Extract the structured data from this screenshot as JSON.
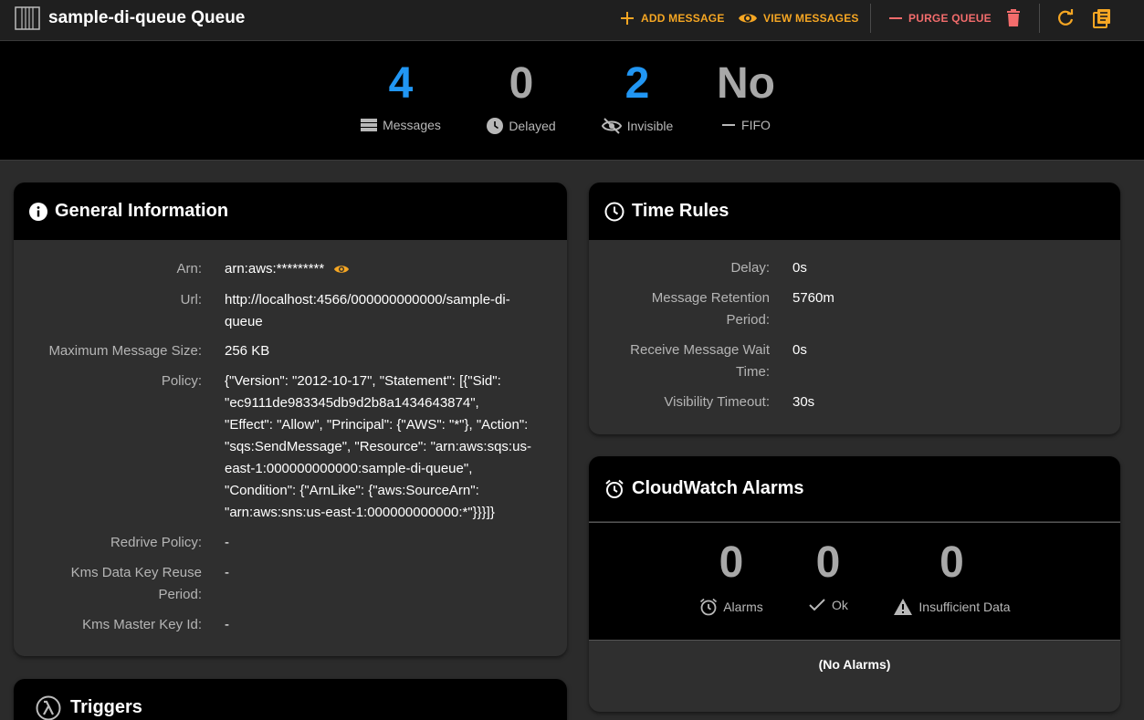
{
  "header": {
    "title": "sample-di-queue Queue",
    "add_message": "ADD MESSAGE",
    "view_messages": "VIEW MESSAGES",
    "purge_queue": "PURGE QUEUE"
  },
  "stats": [
    {
      "value": "4",
      "label": "Messages",
      "icon": "messages-icon",
      "color": "#2196f3"
    },
    {
      "value": "0",
      "label": "Delayed",
      "icon": "clock-icon",
      "color": "#a8a8a8"
    },
    {
      "value": "2",
      "label": "Invisible",
      "icon": "eye-off-icon",
      "color": "#2196f3"
    },
    {
      "value": "No",
      "label": "FIFO",
      "icon": "dash-icon",
      "color": "#a8a8a8"
    }
  ],
  "general": {
    "title": "General Information",
    "arn_label": "Arn:",
    "arn_value": "arn:aws:*********",
    "url_label": "Url:",
    "url_value_line1": "http://localhost:4566/000000000000/sample-di-",
    "url_value_line2": "queue",
    "max_size_label": "Maximum Message Size:",
    "max_size_value": "256 KB",
    "policy_label": "Policy:",
    "policy_lines": [
      "{\"Version\": \"2012-10-17\", \"Statement\": [{\"Sid\":",
      "\"ec9111de983345db9d2b8a1434643874\",",
      "\"Effect\": \"Allow\", \"Principal\": {\"AWS\": \"*\"}, \"Action\":",
      "\"sqs:SendMessage\", \"Resource\": \"arn:aws:sqs:us-",
      "east-1:000000000000:sample-di-queue\",",
      "\"Condition\": {\"ArnLike\": {\"aws:SourceArn\":",
      "\"arn:aws:sns:us-east-1:000000000000:*\"}}}]}"
    ],
    "redrive_label": "Redrive Policy:",
    "redrive_value": "-",
    "kms_reuse_label_line1": "Kms Data Key Reuse",
    "kms_reuse_label_line2": "Period:",
    "kms_reuse_value": "-",
    "kms_master_label": "Kms Master Key Id:",
    "kms_master_value": "-"
  },
  "time_rules": {
    "title": "Time Rules",
    "delay_label": "Delay:",
    "delay_value": "0s",
    "retention_label_line1": "Message Retention",
    "retention_label_line2": "Period:",
    "retention_value": "5760m",
    "wait_label_line1": "Receive Message Wait",
    "wait_label_line2": "Time:",
    "wait_value": "0s",
    "visibility_label": "Visibility Timeout:",
    "visibility_value": "30s"
  },
  "cloudwatch": {
    "title": "CloudWatch Alarms",
    "alarms_value": "0",
    "alarms_label": "Alarms",
    "ok_value": "0",
    "ok_label": "Ok",
    "insufficient_value": "0",
    "insufficient_label": "Insufficient Data",
    "empty_text": "(No Alarms)"
  },
  "triggers": {
    "title": "Triggers"
  },
  "colors": {
    "accent_orange": "#f5a623",
    "danger_red": "#f36c6c",
    "stat_blue": "#2196f3"
  }
}
